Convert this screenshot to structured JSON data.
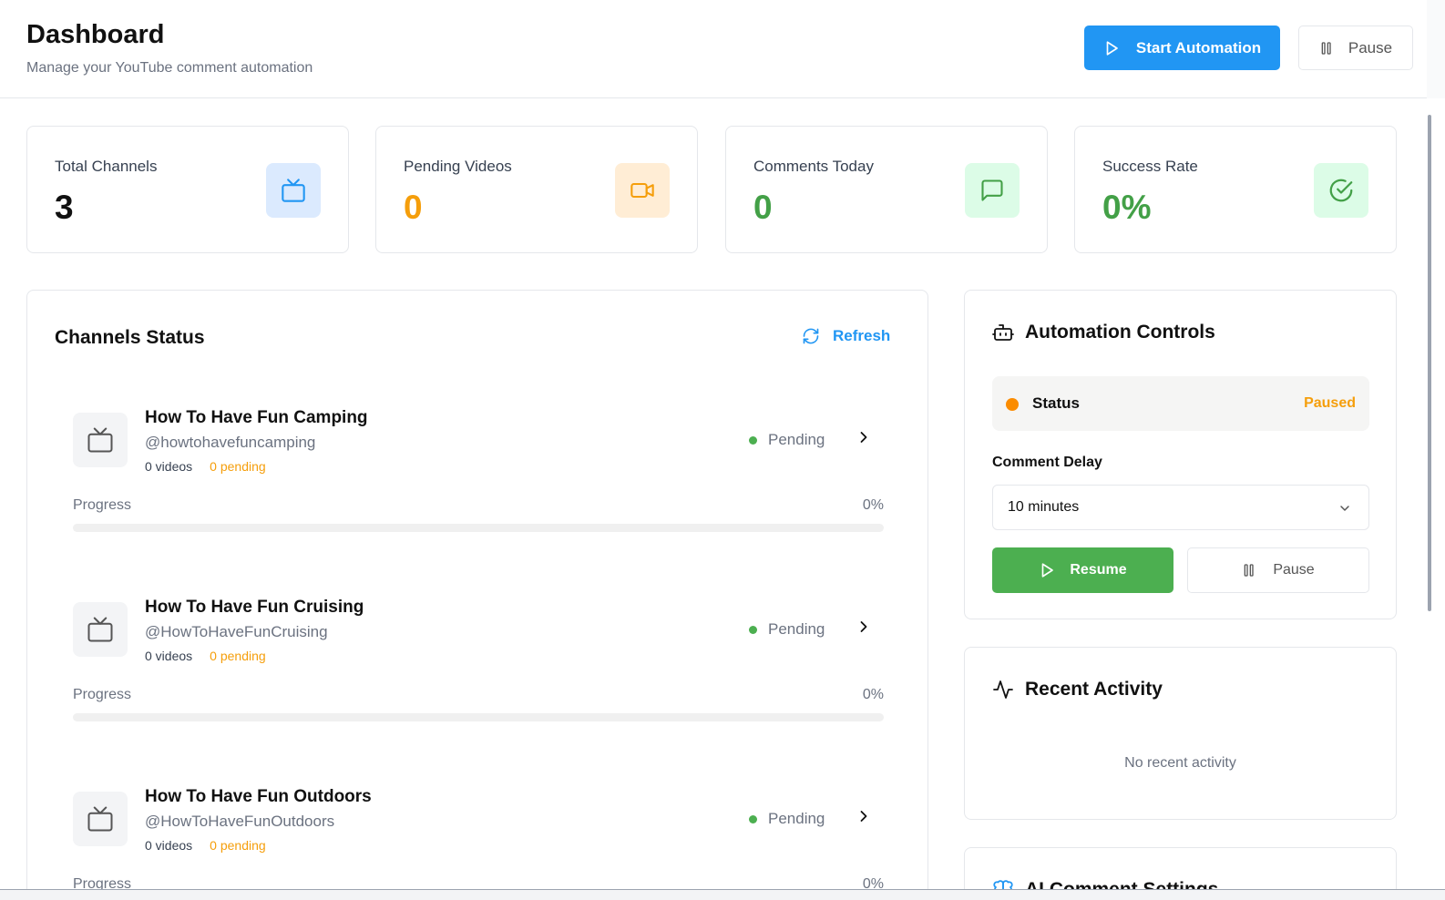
{
  "header": {
    "title": "Dashboard",
    "subtitle": "Manage your YouTube comment automation",
    "start_label": "Start Automation",
    "pause_label": "Pause"
  },
  "stats": [
    {
      "label": "Total Channels",
      "value": "3",
      "icon": "tv-icon",
      "color": "#111111",
      "icon_bg": "#dbeafe",
      "icon_color": "#2196f3"
    },
    {
      "label": "Pending Videos",
      "value": "0",
      "icon": "video-icon",
      "color": "#f59e0b",
      "icon_bg": "#ffedd5",
      "icon_color": "#f59e0b"
    },
    {
      "label": "Comments Today",
      "value": "0",
      "icon": "message-square-icon",
      "color": "#43a047",
      "icon_bg": "#dcfce7",
      "icon_color": "#43a047"
    },
    {
      "label": "Success Rate",
      "value": "0%",
      "icon": "check-circle-icon",
      "color": "#43a047",
      "icon_bg": "#dcfce7",
      "icon_color": "#43a047"
    }
  ],
  "channels_card": {
    "title": "Channels Status",
    "refresh_label": "Refresh",
    "items": [
      {
        "name": "How To Have Fun Camping",
        "handle": "@howtohavefuncamping",
        "videos": "0 videos",
        "pending": "0 pending",
        "status": "Pending",
        "progress_label": "Progress",
        "progress_pct": "0%",
        "progress": 0
      },
      {
        "name": "How To Have Fun Cruising",
        "handle": "@HowToHaveFunCruising",
        "videos": "0 videos",
        "pending": "0 pending",
        "status": "Pending",
        "progress_label": "Progress",
        "progress_pct": "0%",
        "progress": 0
      },
      {
        "name": "How To Have Fun Outdoors",
        "handle": "@HowToHaveFunOutdoors",
        "videos": "0 videos",
        "pending": "0 pending",
        "status": "Pending",
        "progress_label": "Progress",
        "progress_pct": "0%",
        "progress": 0
      }
    ]
  },
  "automation": {
    "title": "Automation Controls",
    "status_label": "Status",
    "status_value": "Paused",
    "delay_label": "Comment Delay",
    "delay_value": "10 minutes",
    "resume_label": "Resume",
    "pause_label": "Pause"
  },
  "activity": {
    "title": "Recent Activity",
    "empty": "No recent activity"
  },
  "ai_settings": {
    "title": "AI Comment Settings"
  },
  "colors": {
    "primary": "#2196f3",
    "success": "#4caf50",
    "warning": "#f59e0b"
  }
}
